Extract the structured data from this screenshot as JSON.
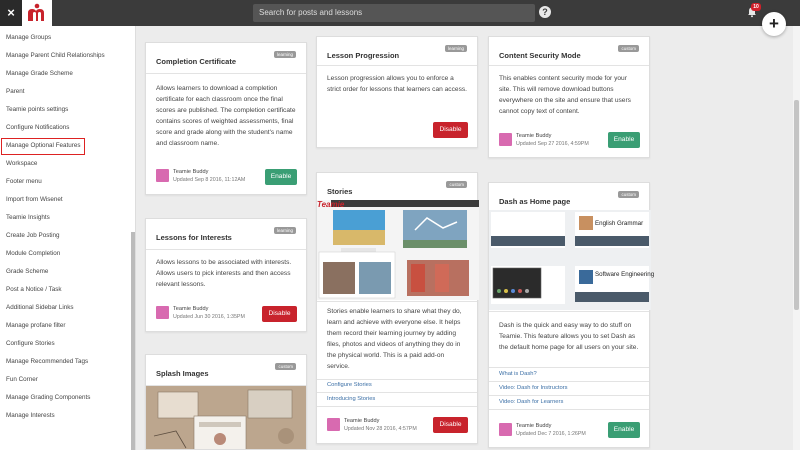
{
  "topbar": {
    "close_glyph": "×",
    "search_placeholder": "Search for posts and lessons",
    "help_glyph": "?",
    "notification_count": "10",
    "add_glyph": "+"
  },
  "sidebar": {
    "items": [
      {
        "label": "Manage Groups"
      },
      {
        "label": "Manage Parent Child Relationships"
      },
      {
        "label": "Manage Grade Scheme"
      },
      {
        "label": "Parent"
      },
      {
        "label": "Teamie points settings"
      },
      {
        "label": "Configure Notifications"
      },
      {
        "label": "Manage Optional Features",
        "active": true
      },
      {
        "label": "Workspace"
      },
      {
        "label": "Footer menu"
      },
      {
        "label": "Import from Wisenet"
      },
      {
        "label": "Teamie Insights"
      },
      {
        "label": "Create Job Posting"
      },
      {
        "label": "Module Completion"
      },
      {
        "label": "Grade Scheme"
      },
      {
        "label": "Post a Notice / Task"
      },
      {
        "label": "Additional Sidebar Links"
      },
      {
        "label": "Manage profane filter"
      },
      {
        "label": "Configure Stories"
      },
      {
        "label": "Manage Recommended Tags"
      },
      {
        "label": "Fun Corner"
      },
      {
        "label": "Manage Grading Components"
      },
      {
        "label": "Manage Interests"
      }
    ]
  },
  "cards": {
    "completion": {
      "title": "Completion Certificate",
      "tag": "learning",
      "desc": "Allows learners to download a completion certificate for each classroom once the final scores are published. The completion certificate contains scores of weighted assessments, final score and grade along with the student's name and classroom name.",
      "author": "Teamie Buddy",
      "date": "Updated Sep 8 2016, 11:12AM",
      "button": "Enable"
    },
    "interests": {
      "title": "Lessons for Interests",
      "tag": "learning",
      "desc": "Allows lessons to be associated with interests. Allows users to pick interests and then access relevant lessons.",
      "author": "Teamie Buddy",
      "date": "Updated Jun 30 2016, 1:35PM",
      "button": "Disable"
    },
    "splash": {
      "title": "Splash Images",
      "tag": "custom"
    },
    "progression": {
      "title": "Lesson Progression",
      "tag": "learning",
      "desc": "Lesson progression allows you to enforce a strict order for lessons that learners can access.",
      "button": "Disable"
    },
    "stories": {
      "title": "Stories",
      "tag": "custom",
      "logo_text": "Teamie",
      "desc": "Stories enable learners to share what they do, learn and achieve with everyone else. It helps them record their learning journey by adding files, photos and videos of anything they do in the physical world. This is a paid add-on service.",
      "link1": "Configure Stories",
      "link2": "Introducing Stories",
      "author": "Teamie Buddy",
      "date": "Updated Nov 28 2016, 4:57PM",
      "button": "Disable"
    },
    "security": {
      "title": "Content Security Mode",
      "tag": "custom",
      "desc": "This enables content security mode for your site. This will remove download buttons everywhere on the site and ensure that users cannot copy text of content.",
      "author": "Teamie Buddy",
      "date": "Updated Sep 27 2016, 4:59PM",
      "button": "Enable"
    },
    "dash": {
      "title": "Dash as Home page",
      "tag": "custom",
      "tile1": "English Grammar",
      "tile2": "Software Engineering",
      "desc": "Dash is the quick and easy way to do stuff on Teamie. This feature allows you to set Dash as the default home page for all users on your site.",
      "link1": "What is Dash?",
      "link2": "Video: Dash for Instructors",
      "link3": "Video: Dash for Learners",
      "author": "Teamie Buddy",
      "date": "Updated Dec 7 2016, 1:26PM",
      "button": "Enable"
    }
  },
  "colors": {
    "topbar": "#3b3b3b",
    "enable": "#3a9e74",
    "disable": "#c8232c",
    "logo_red": "#c8232c",
    "active_border": "#dd2222",
    "link": "#3a6ea5"
  }
}
